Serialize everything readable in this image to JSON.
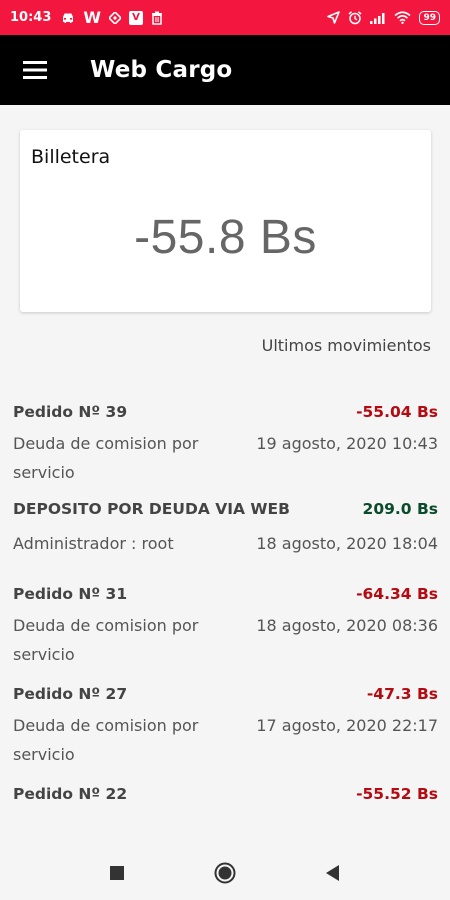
{
  "status_bar": {
    "time": "10:43",
    "battery": "99",
    "left_icons": [
      "car-icon",
      "w-app-icon",
      "diamond-icon",
      "v-app-icon",
      "trash-icon"
    ],
    "right_icons": [
      "location-arrow-icon",
      "alarm-icon",
      "signal-icon",
      "wifi-icon",
      "battery-icon"
    ],
    "w_glyph": "W",
    "v_glyph": "V"
  },
  "app_bar": {
    "title": "Web Cargo"
  },
  "wallet": {
    "title": "Billetera",
    "balance": "-55.8 Bs"
  },
  "recent_title": "Ultimos movimientos",
  "movements": [
    {
      "title": "Pedido Nº 39",
      "amount": "-55.04 Bs",
      "type": "negative",
      "description": "Deuda de comision por servicio",
      "date": "19 agosto, 2020 10:43"
    },
    {
      "title": "DEPOSITO POR DEUDA VIA WEB",
      "amount": "209.0 Bs",
      "type": "positive",
      "description": "Administrador : root",
      "date": "18 agosto, 2020 18:04"
    },
    {
      "title": "Pedido Nº 31",
      "amount": "-64.34 Bs",
      "type": "negative",
      "description": "Deuda de comision por servicio",
      "date": "18 agosto, 2020 08:36"
    },
    {
      "title": "Pedido Nº 27",
      "amount": "-47.3 Bs",
      "type": "negative",
      "description": "Deuda de comision por servicio",
      "date": "17 agosto, 2020 22:17"
    },
    {
      "title": "Pedido Nº 22",
      "amount": "-55.52 Bs",
      "type": "negative",
      "description": "",
      "date": ""
    }
  ],
  "colors": {
    "status_bar": "#f3163f",
    "app_bar": "#000000",
    "negative": "#b40b12",
    "positive": "#0b4a2a"
  },
  "nav": {
    "buttons": [
      "recents-square-icon",
      "home-circle-icon",
      "back-triangle-icon"
    ]
  }
}
